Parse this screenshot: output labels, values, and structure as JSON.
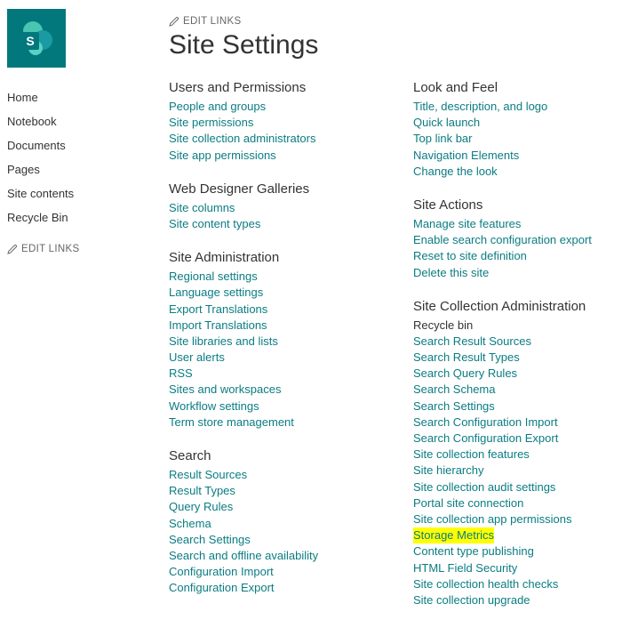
{
  "header": {
    "edit_links_label": "EDIT LINKS",
    "page_title": "Site Settings"
  },
  "sidebar": {
    "items": [
      {
        "label": "Home"
      },
      {
        "label": "Notebook"
      },
      {
        "label": "Documents"
      },
      {
        "label": "Pages"
      },
      {
        "label": "Site contents"
      },
      {
        "label": "Recycle Bin"
      }
    ],
    "edit_links_label": "EDIT LINKS"
  },
  "columns": [
    {
      "sections": [
        {
          "heading": "Users and Permissions",
          "links": [
            "People and groups",
            "Site permissions",
            "Site collection administrators",
            "Site app permissions"
          ]
        },
        {
          "heading": "Web Designer Galleries",
          "links": [
            "Site columns",
            "Site content types"
          ]
        },
        {
          "heading": "Site Administration",
          "links": [
            "Regional settings",
            "Language settings",
            "Export Translations",
            "Import Translations",
            "Site libraries and lists",
            "User alerts",
            "RSS",
            "Sites and workspaces",
            "Workflow settings",
            "Term store management"
          ]
        },
        {
          "heading": "Search",
          "links": [
            "Result Sources",
            "Result Types",
            "Query Rules",
            "Schema",
            "Search Settings",
            "Search and offline availability",
            "Configuration Import",
            "Configuration Export"
          ]
        }
      ]
    },
    {
      "sections": [
        {
          "heading": "Look and Feel",
          "links": [
            "Title, description, and logo",
            "Quick launch",
            "Top link bar",
            "Navigation Elements",
            "Change the look"
          ]
        },
        {
          "heading": "Site Actions",
          "links": [
            "Manage site features",
            "Enable search configuration export",
            "Reset to site definition",
            "Delete this site"
          ]
        },
        {
          "heading": "Site Collection Administration",
          "links": [
            {
              "label": "Recycle bin",
              "dim": true
            },
            "Search Result Sources",
            "Search Result Types",
            "Search Query Rules",
            "Search Schema",
            "Search Settings",
            "Search Configuration Import",
            "Search Configuration Export",
            "Site collection features",
            "Site hierarchy",
            "Site collection audit settings",
            "Portal site connection",
            "Site collection app permissions",
            {
              "label": "Storage Metrics",
              "highlight": true
            },
            "Content type publishing",
            "HTML Field Security",
            "Site collection health checks",
            "Site collection upgrade"
          ]
        }
      ]
    }
  ]
}
